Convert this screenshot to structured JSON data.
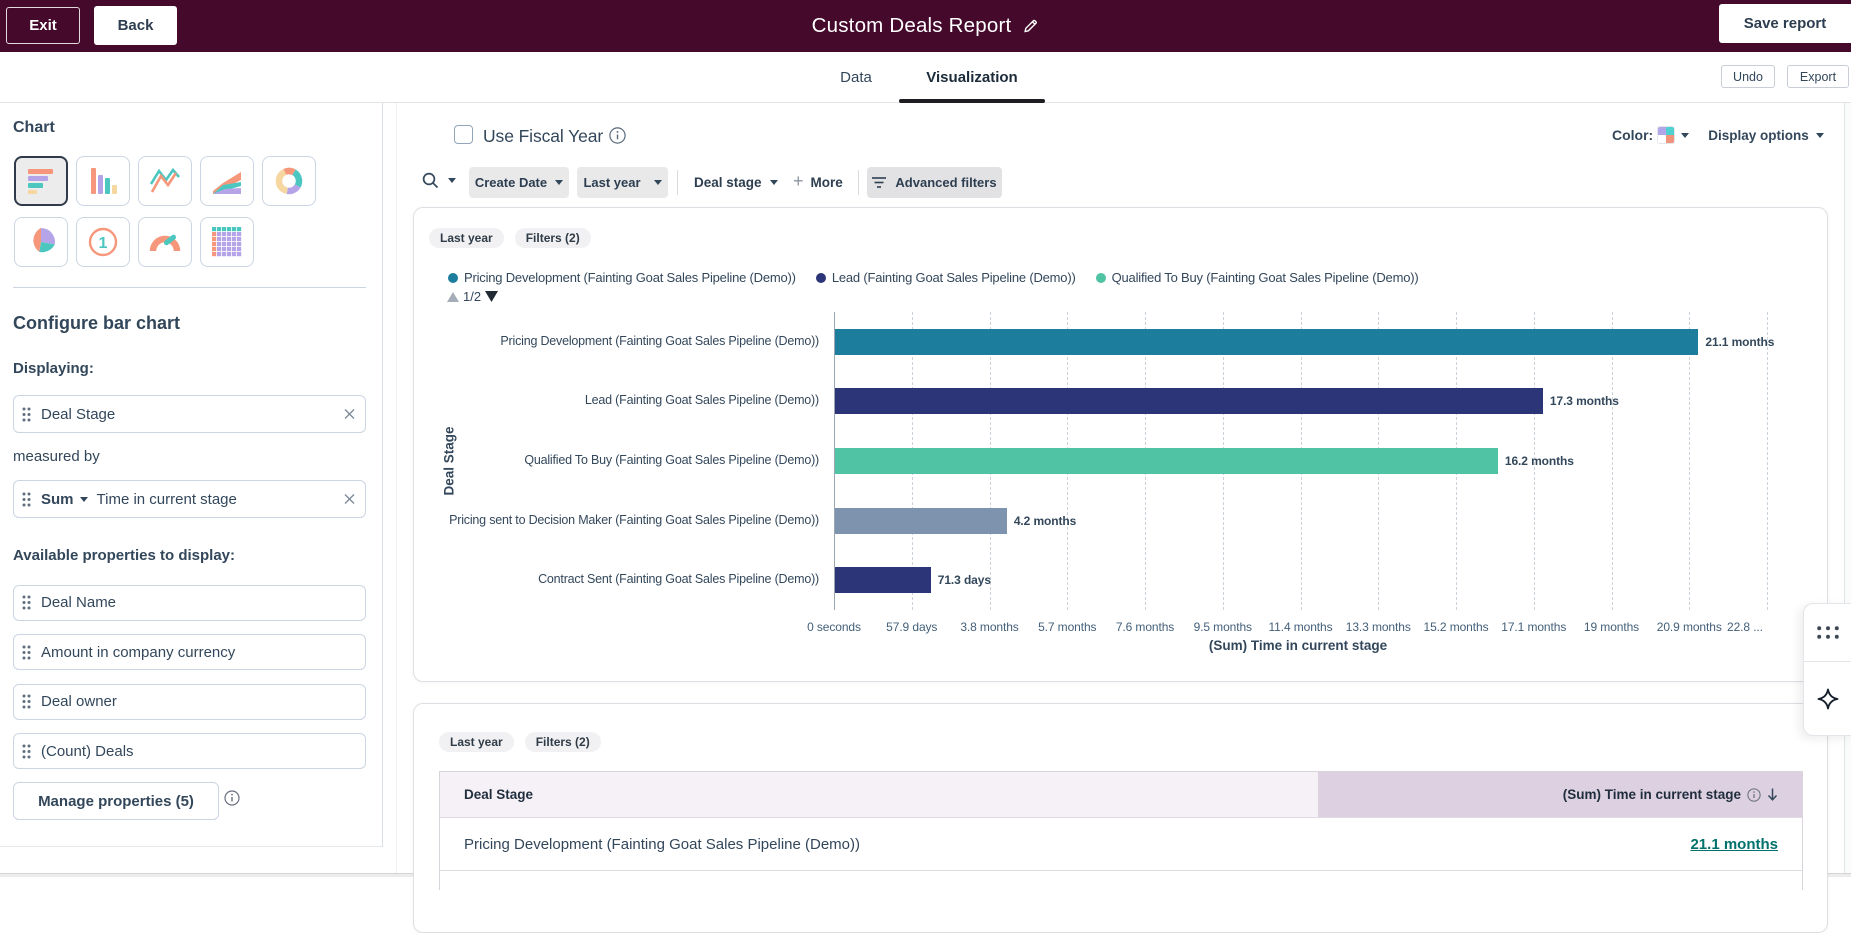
{
  "header": {
    "exit_label": "Exit",
    "back_label": "Back",
    "title": "Custom Deals Report",
    "save_label": "Save report",
    "bar_color": "#45092b"
  },
  "tabs": {
    "data_label": "Data",
    "visualization_label": "Visualization",
    "active": "Visualization",
    "undo_label": "Undo",
    "export_label": "Export"
  },
  "sidebar": {
    "chart_heading": "Chart",
    "chart_types": [
      {
        "name": "horizontal-bar",
        "selected": true
      },
      {
        "name": "column",
        "selected": false
      },
      {
        "name": "line",
        "selected": false
      },
      {
        "name": "area",
        "selected": false
      },
      {
        "name": "donut",
        "selected": false
      },
      {
        "name": "pie",
        "selected": false
      },
      {
        "name": "summary",
        "selected": false
      },
      {
        "name": "gauge",
        "selected": false
      },
      {
        "name": "table",
        "selected": false
      }
    ],
    "configure_heading": "Configure bar chart",
    "displaying_label": "Displaying:",
    "displaying_field": "Deal Stage",
    "measured_by_label": "measured by",
    "measure_aggregation": "Sum",
    "measure_field": "Time in current stage",
    "available_label": "Available properties to display:",
    "properties": [
      "Deal Name",
      "Amount in company currency",
      "Deal owner",
      "(Count) Deals"
    ],
    "manage_button": "Manage properties (5)"
  },
  "toolbar": {
    "fiscal_label": "Use Fiscal Year",
    "color_label": "Color:",
    "display_options_label": "Display options",
    "swatch_colors": [
      "#b3a6e8",
      "#4fd1cf",
      "#ffffff",
      "#f2937c"
    ],
    "filters": {
      "date_property": "Create Date",
      "date_range": "Last year",
      "stage": "Deal stage",
      "more_label": "More",
      "advanced_label": "Advanced filters"
    }
  },
  "chart_card": {
    "tags": [
      "Last year",
      "Filters (2)"
    ],
    "legend_page": "1/2"
  },
  "chart_data": {
    "type": "bar",
    "orientation": "horizontal",
    "xlabel": "(Sum) Time in current stage",
    "ylabel": "Deal Stage",
    "xlim_months": [
      0,
      22.8
    ],
    "grid": true,
    "legend_position": "top",
    "categories": [
      "Pricing Development (Fainting Goat Sales Pipeline (Demo))",
      "Lead (Fainting Goat Sales Pipeline (Demo))",
      "Qualified To Buy (Fainting Goat Sales Pipeline (Demo))",
      "Pricing sent to Decision Maker (Fainting Goat Sales Pipeline (Demo))",
      "Contract Sent (Fainting Goat Sales Pipeline (Demo))"
    ],
    "values": [
      {
        "label": "21.1 months",
        "months": 21.1,
        "color": "#1c7d9c"
      },
      {
        "label": "17.3 months",
        "months": 17.3,
        "color": "#2b3577"
      },
      {
        "label": "16.2 months",
        "months": 16.2,
        "color": "#4fc3a4"
      },
      {
        "label": "4.2 months",
        "months": 4.2,
        "color": "#7e93ad"
      },
      {
        "label": "71.3 days",
        "months": 2.34,
        "color": "#2b3577"
      }
    ],
    "x_ticks": [
      {
        "label": "0 seconds",
        "months": 0
      },
      {
        "label": "57.9 days",
        "months": 1.9
      },
      {
        "label": "3.8 months",
        "months": 3.8
      },
      {
        "label": "5.7 months",
        "months": 5.7
      },
      {
        "label": "7.6 months",
        "months": 7.6
      },
      {
        "label": "9.5 months",
        "months": 9.5
      },
      {
        "label": "11.4 months",
        "months": 11.4
      },
      {
        "label": "13.3 months",
        "months": 13.3
      },
      {
        "label": "15.2 months",
        "months": 15.2
      },
      {
        "label": "17.1 months",
        "months": 17.1
      },
      {
        "label": "19 months",
        "months": 19
      },
      {
        "label": "20.9 months",
        "months": 20.9
      },
      {
        "label": "22.8 ...",
        "months": 22.8,
        "truncated": true
      }
    ],
    "legend": [
      {
        "label": "Pricing Development (Fainting Goat Sales Pipeline (Demo))",
        "color": "#1c7d9c"
      },
      {
        "label": "Lead (Fainting Goat Sales Pipeline (Demo))",
        "color": "#2b3577"
      },
      {
        "label": "Qualified To Buy (Fainting Goat Sales Pipeline (Demo))",
        "color": "#4fc3a4"
      }
    ]
  },
  "table_card": {
    "tags": [
      "Last year",
      "Filters (2)"
    ],
    "columns": [
      "Deal Stage",
      "(Sum) Time in current stage"
    ],
    "rows": [
      {
        "stage": "Pricing Development (Fainting Goat Sales Pipeline (Demo))",
        "value": "21.1 months"
      }
    ]
  }
}
